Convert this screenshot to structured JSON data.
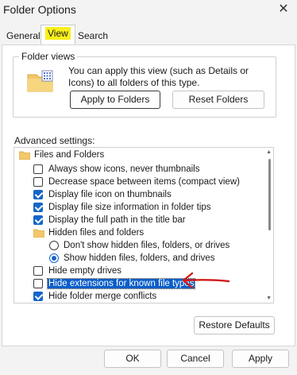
{
  "window": {
    "title": "Folder Options",
    "close_glyph": "✕"
  },
  "tabs": [
    {
      "label": "General"
    },
    {
      "label": "View",
      "active": true,
      "highlight": "#f9ef1a"
    },
    {
      "label": "Search"
    }
  ],
  "folder_views": {
    "legend": "Folder views",
    "description": "You can apply this view (such as Details or Icons) to all folders of this type.",
    "apply_button": "Apply to Folders",
    "reset_button": "Reset Folders",
    "icon": "folder-grid-icon"
  },
  "advanced": {
    "label": "Advanced settings:",
    "items": [
      {
        "type": "folder",
        "label": "Files and Folders"
      },
      {
        "type": "checkbox",
        "checked": false,
        "label": "Always show icons, never thumbnails"
      },
      {
        "type": "checkbox",
        "checked": false,
        "label": "Decrease space between items (compact view)"
      },
      {
        "type": "checkbox",
        "checked": true,
        "label": "Display file icon on thumbnails"
      },
      {
        "type": "checkbox",
        "checked": true,
        "label": "Display file size information in folder tips"
      },
      {
        "type": "checkbox",
        "checked": true,
        "label": "Display the full path in the title bar"
      },
      {
        "type": "folder",
        "label": "Hidden files and folders"
      },
      {
        "type": "radio",
        "checked": false,
        "label": "Don't show hidden files, folders, or drives"
      },
      {
        "type": "radio",
        "checked": true,
        "label": "Show hidden files, folders, and drives"
      },
      {
        "type": "checkbox",
        "checked": false,
        "label": "Hide empty drives"
      },
      {
        "type": "checkbox",
        "checked": false,
        "selected": true,
        "label": "Hide extensions for known file types"
      },
      {
        "type": "checkbox",
        "checked": true,
        "label": "Hide folder merge conflicts"
      }
    ]
  },
  "buttons": {
    "restore_defaults": "Restore Defaults",
    "ok": "OK",
    "cancel": "Cancel",
    "apply": "Apply"
  },
  "colors": {
    "accent": "#1565c8",
    "selection": "#0a5ec9",
    "annotation_arrow": "#d11a1a"
  }
}
